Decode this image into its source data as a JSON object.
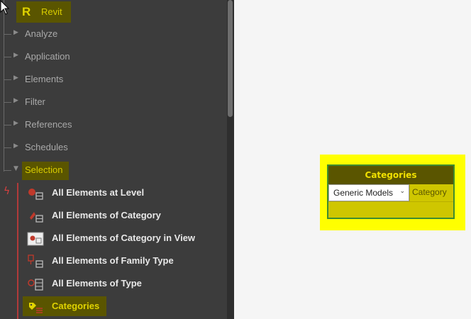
{
  "library": {
    "root_label": "Revit",
    "root_logo": "R",
    "categories": [
      {
        "label": "Analyze"
      },
      {
        "label": "Application"
      },
      {
        "label": "Elements"
      },
      {
        "label": "Filter"
      },
      {
        "label": "References"
      },
      {
        "label": "Schedules"
      },
      {
        "label": "Selection"
      }
    ],
    "selection_nodes": [
      {
        "label": "All Elements at Level",
        "icon": "level-elements-icon"
      },
      {
        "label": "All Elements of Category",
        "icon": "category-elements-icon"
      },
      {
        "label": "All Elements of Category in View",
        "icon": "category-in-view-icon"
      },
      {
        "label": "All Elements of Family Type",
        "icon": "family-type-icon"
      },
      {
        "label": "All Elements of Type",
        "icon": "type-elements-icon"
      },
      {
        "label": "Categories",
        "icon": "categories-icon"
      }
    ]
  },
  "node": {
    "title": "Categories",
    "dropdown_value": "Generic Models",
    "output_label": "Category"
  },
  "colors": {
    "accent": "#ffff00",
    "highlight_bg": "#5a5500",
    "highlight_text": "#d8cc00",
    "panel_bg": "#3c3c3c",
    "canvas_bg": "#f5f5f5",
    "node_border": "#3f8c2f"
  }
}
